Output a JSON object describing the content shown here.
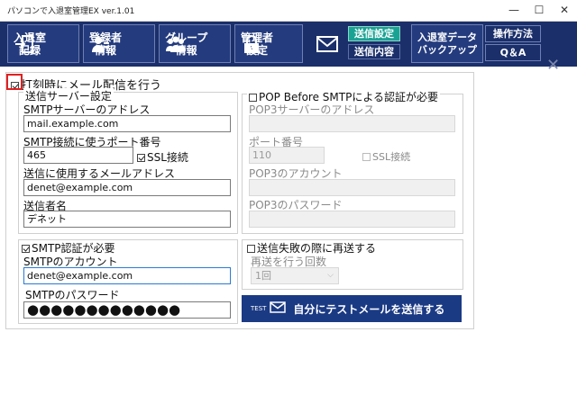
{
  "window": {
    "title": "パソコンで入退室管理EX ver.1.01",
    "minimize": "—",
    "maximize": "☐",
    "close": "✕"
  },
  "nav": {
    "items": [
      {
        "label": "入退室\n記録",
        "icon": "enter-exit-icon"
      },
      {
        "label": "登録者\n情報",
        "icon": "user-icon"
      },
      {
        "label": "グループ\n情報",
        "icon": "group-icon"
      },
      {
        "label": "管理者\n設定",
        "icon": "lock-icon"
      }
    ],
    "mail": {
      "icon": "mail-icon",
      "sub_on": "送信設定",
      "sub_off": "送信内容"
    },
    "backup": "入退室データ\nバックアップ",
    "howto": "操作方法",
    "qa": "Q＆A",
    "close": "✕"
  },
  "main": {
    "send_on_punch": {
      "label": "打刻時にメール配信を行う",
      "checked": true
    },
    "server": {
      "title": "送信サーバー設定",
      "smtp_address_label": "SMTPサーバーのアドレス",
      "smtp_address": "mail.example.com",
      "port_label": "SMTP接続に使うポート番号",
      "port": "465",
      "ssl_label": "SSL接続",
      "from_address_label": "送信に使用するメールアドレス",
      "from_address": "denet@example.com",
      "sender_name_label": "送信者名",
      "sender_name": "デネット"
    },
    "pop": {
      "title": "POP Before SMTPによる認証が必要",
      "address_label": "POP3サーバーのアドレス",
      "address": "",
      "port_label": "ポート番号",
      "port": "110",
      "ssl_label": "SSL接続",
      "account_label": "POP3のアカウント",
      "account": "",
      "password_label": "POP3のパスワード",
      "password": ""
    },
    "smtp_auth": {
      "title": "SMTP認証が必要",
      "account_label": "SMTPのアカウント",
      "account": "denet@example.com",
      "password_label": "SMTPのパスワード",
      "password": "●●●●●●●●●●●●●"
    },
    "retry": {
      "title": "送信失敗の際に再送する",
      "count_label": "再送を行う回数",
      "count": "1回"
    },
    "test": {
      "tag": "TEST",
      "label": "自分にテストメールを送信する"
    }
  }
}
